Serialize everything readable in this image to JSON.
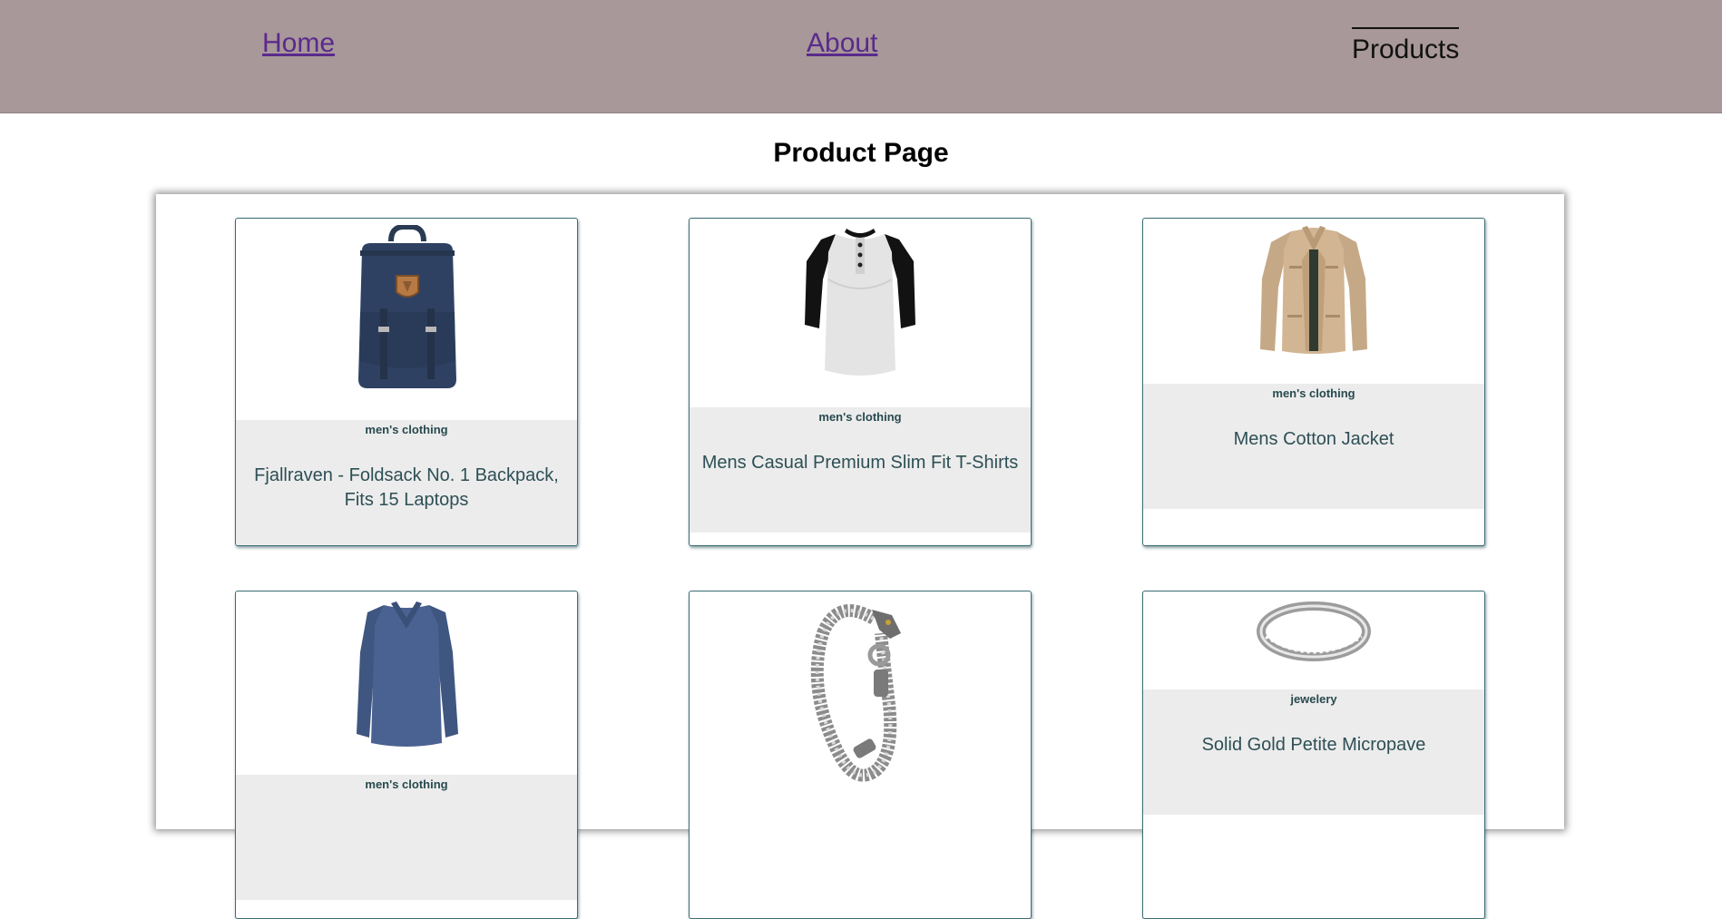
{
  "nav": {
    "home": "Home",
    "about": "About",
    "products": "Products"
  },
  "page_title": "Product Page",
  "products": [
    {
      "category": "men's clothing",
      "title": "Fjallraven - Foldsack No. 1 Backpack, Fits 15 Laptops",
      "image": "backpack"
    },
    {
      "category": "men's clothing",
      "title": "Mens Casual Premium Slim Fit T-Shirts",
      "image": "raglan-t-shirt"
    },
    {
      "category": "men's clothing",
      "title": "Mens Cotton Jacket",
      "image": "cotton-jacket"
    },
    {
      "category": "men's clothing",
      "title": "",
      "image": "long-sleeve-shirt"
    },
    {
      "category": "",
      "title": "",
      "image": "dragon-chain-bracelet"
    },
    {
      "category": "jewelery",
      "title": "Solid Gold Petite Micropave",
      "image": "silver-ring"
    }
  ],
  "colors": {
    "navbar": "#a89899",
    "nav_link": "#5a2a8c",
    "card_border": "#3c6e74",
    "card_info_bg": "#ececec"
  }
}
